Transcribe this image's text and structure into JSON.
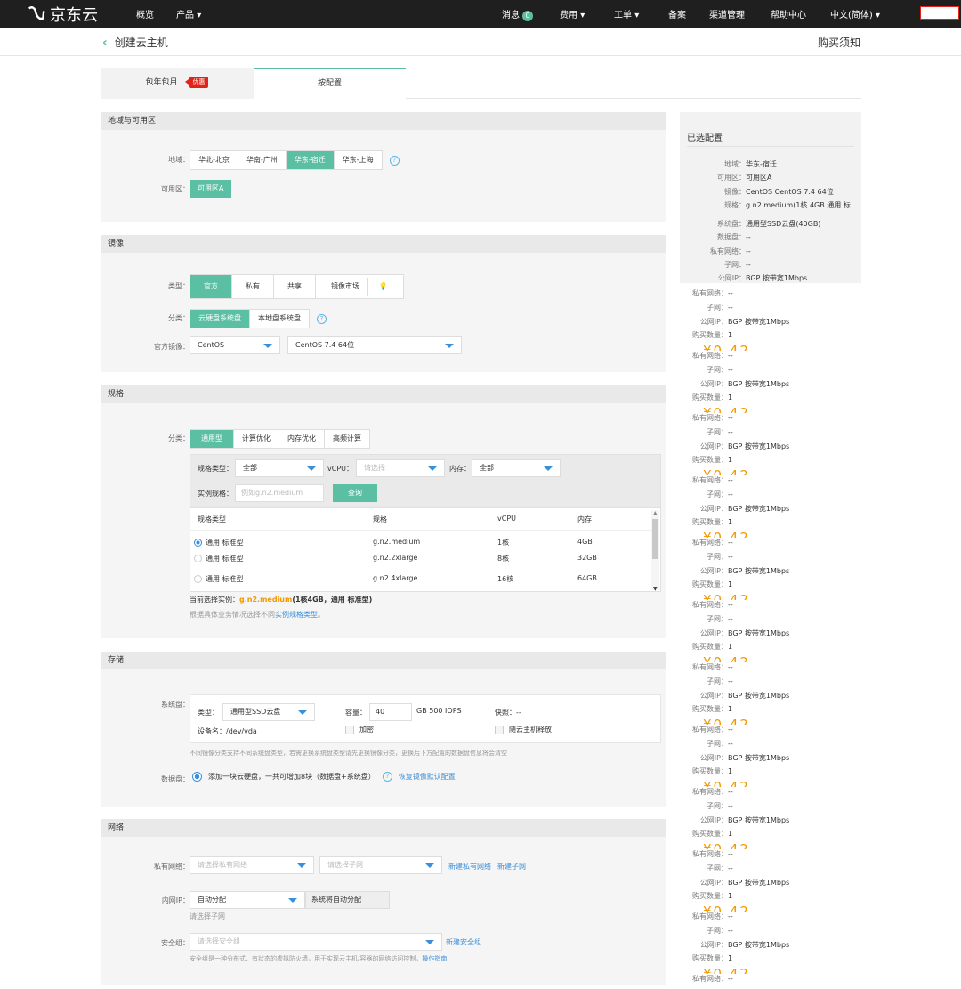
{
  "topbar": {
    "logo": "京东云",
    "nav_overview": "概览",
    "nav_products": "产品",
    "messages": "消息",
    "messages_count": "0",
    "nav_cost": "费用",
    "nav_ticket": "工单",
    "nav_icp": "备案",
    "nav_channel": "渠道管理",
    "nav_help": "帮助中心",
    "nav_lang": "中文(简体)"
  },
  "header": {
    "back_title": "创建云主机",
    "buy_notice": "购买须知"
  },
  "tabs": {
    "yearly": "包年包月",
    "promo": "优惠",
    "on_demand": "按配置"
  },
  "region": {
    "section_title": "地域与可用区",
    "region_label": "地域：",
    "regions": [
      "华北-北京",
      "华南-广州",
      "华东-宿迁",
      "华东-上海"
    ],
    "az_label": "可用区：",
    "az_value": "可用区A"
  },
  "image": {
    "section_title": "镜像",
    "type_label": "类型：",
    "types": [
      "官方",
      "私有",
      "共享",
      "镜像市场"
    ],
    "category_label": "分类：",
    "categories": [
      "云硬盘系统盘",
      "本地盘系统盘"
    ],
    "official_label": "官方镜像：",
    "os_family": "CentOS",
    "os_version": "CentOS 7.4 64位"
  },
  "spec": {
    "section_title": "规格",
    "category_label": "分类：",
    "categories": [
      "通用型",
      "计算优化",
      "内存优化",
      "高频计算"
    ],
    "filter_type_label": "规格类型：",
    "filter_type_value": "全部",
    "filter_vcpu_label": "vCPU：",
    "filter_vcpu_placeholder": "请选择",
    "filter_mem_label": "内存：",
    "filter_mem_value": "全部",
    "instance_label": "实例规格：",
    "instance_placeholder": "例如g.n2.medium",
    "query_button": "查询",
    "columns": [
      "规格类型",
      "规格",
      "vCPU",
      "内存"
    ],
    "rows": [
      {
        "type": "通用 标准型",
        "spec": "g.n2.medium",
        "vcpu": "1核",
        "mem": "4GB"
      },
      {
        "type": "通用 标准型",
        "spec": "g.n2.2xlarge",
        "vcpu": "8核",
        "mem": "32GB"
      },
      {
        "type": "通用 标准型",
        "spec": "g.n2.4xlarge",
        "vcpu": "16核",
        "mem": "64GB"
      }
    ],
    "current_prefix": "当前选择实例：",
    "current_spec": "g.n2.medium",
    "current_detail": "(1核4GB，通用 标准型)",
    "hint_prefix": "根据具体业务情况选择不同",
    "hint_link": "实例规格类型",
    "hint_suffix": "。"
  },
  "storage": {
    "section_title": "存储",
    "sys_disk_label": "系统盘：",
    "type_label": "类型：",
    "type_value": "通用型SSD云盘",
    "capacity_label": "容量：",
    "capacity_value": "40",
    "capacity_unit": "GB  500 IOPS",
    "snapshot_label": "快照：--",
    "device_label": "设备名：/dev/vda",
    "encrypt_label": "加密",
    "release_label": "随云主机释放",
    "note": "不同镜像分类支持不同系统盘类型，若需更换系统盘类型请先更换镜像分类，更换后下方配置的数据盘信息将会清空",
    "data_disk_label": "数据盘：",
    "data_disk_text": "添加一块云硬盘，一共可增加8块（数据盘+系统盘）",
    "restore_link": "恢复镜像默认配置"
  },
  "network": {
    "section_title": "网络",
    "vpc_label": "私有网络：",
    "vpc_placeholder": "请选择私有网络",
    "subnet_placeholder": "请选择子网",
    "new_vpc": "新建私有网络",
    "new_subnet": "新建子网",
    "ip_label": "内网IP：",
    "ip_value": "自动分配",
    "ip_note": "系统将自动分配",
    "ip_hint": "请选择子网",
    "sg_label": "安全组：",
    "sg_placeholder": "请选择安全组",
    "new_sg": "新建安全组",
    "sg_note": "安全组是一种分布式、有状态的虚拟防火墙，用于实现云主机/容器的网络访问控制，",
    "sg_link": "操作指南"
  },
  "summary": {
    "title": "已选配置",
    "lines": [
      {
        "k": "地域：",
        "v": "华东-宿迁"
      },
      {
        "k": "可用区：",
        "v": "可用区A"
      },
      {
        "k": "镜像：",
        "v": "CentOS CentOS 7.4 64位"
      },
      {
        "k": "规格：",
        "v": "g.n2.medium(1核 4GB 通用 标..."
      },
      {
        "k": "系统盘：",
        "v": "通用型SSD云盘(40GB)"
      },
      {
        "k": "数据盘：",
        "v": "--"
      },
      {
        "k": "私有网络：",
        "v": "--"
      },
      {
        "k": "子网：",
        "v": "--"
      },
      {
        "k": "公网IP：",
        "v": "BGP 按带宽1Mbps"
      }
    ],
    "ghost_vpc": "私有网络：",
    "ghost_vpc_v": "--",
    "ghost_subnet": "子网：",
    "ghost_subnet_v": "--",
    "ghost_ip": "公网IP：",
    "ghost_ip_v": "BGP 按带宽1Mbps",
    "ghost_count": "购买数量：",
    "ghost_count_v": "1",
    "ghost_price_label": "配置费用：",
    "ghost_price": "¥0.42..."
  },
  "colors": {
    "accent": "#5bc0a3",
    "link": "#3b8fd9",
    "price": "#f39800",
    "promo": "#e2231a"
  }
}
